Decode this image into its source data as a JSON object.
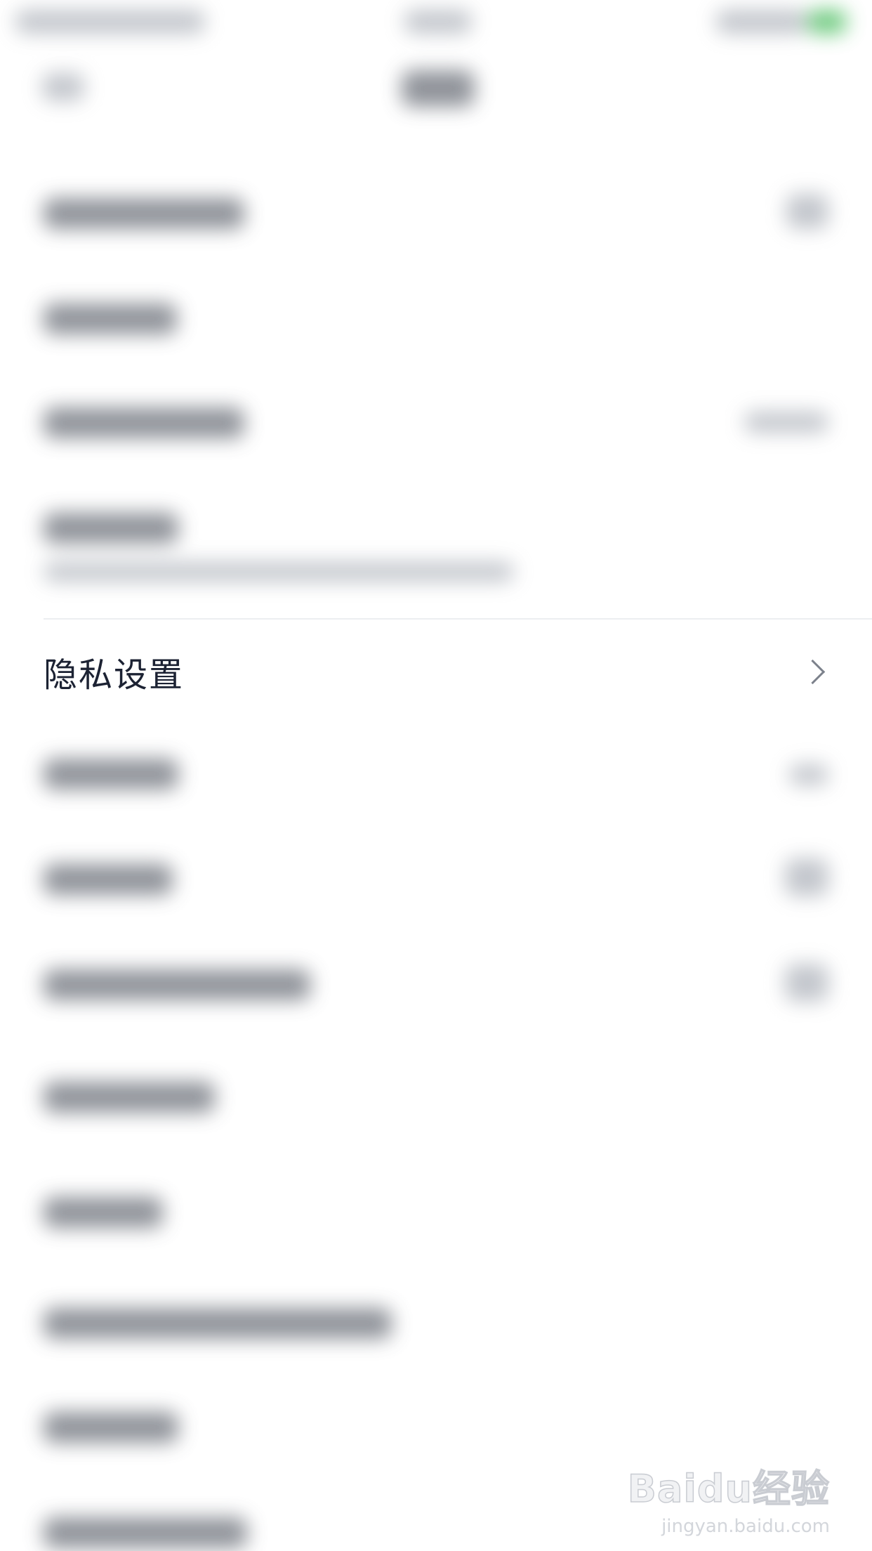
{
  "privacy_row": {
    "label": "隐私设置"
  },
  "watermark": {
    "logo": "Baidu经验",
    "url": "jingyan.baidu.com"
  }
}
